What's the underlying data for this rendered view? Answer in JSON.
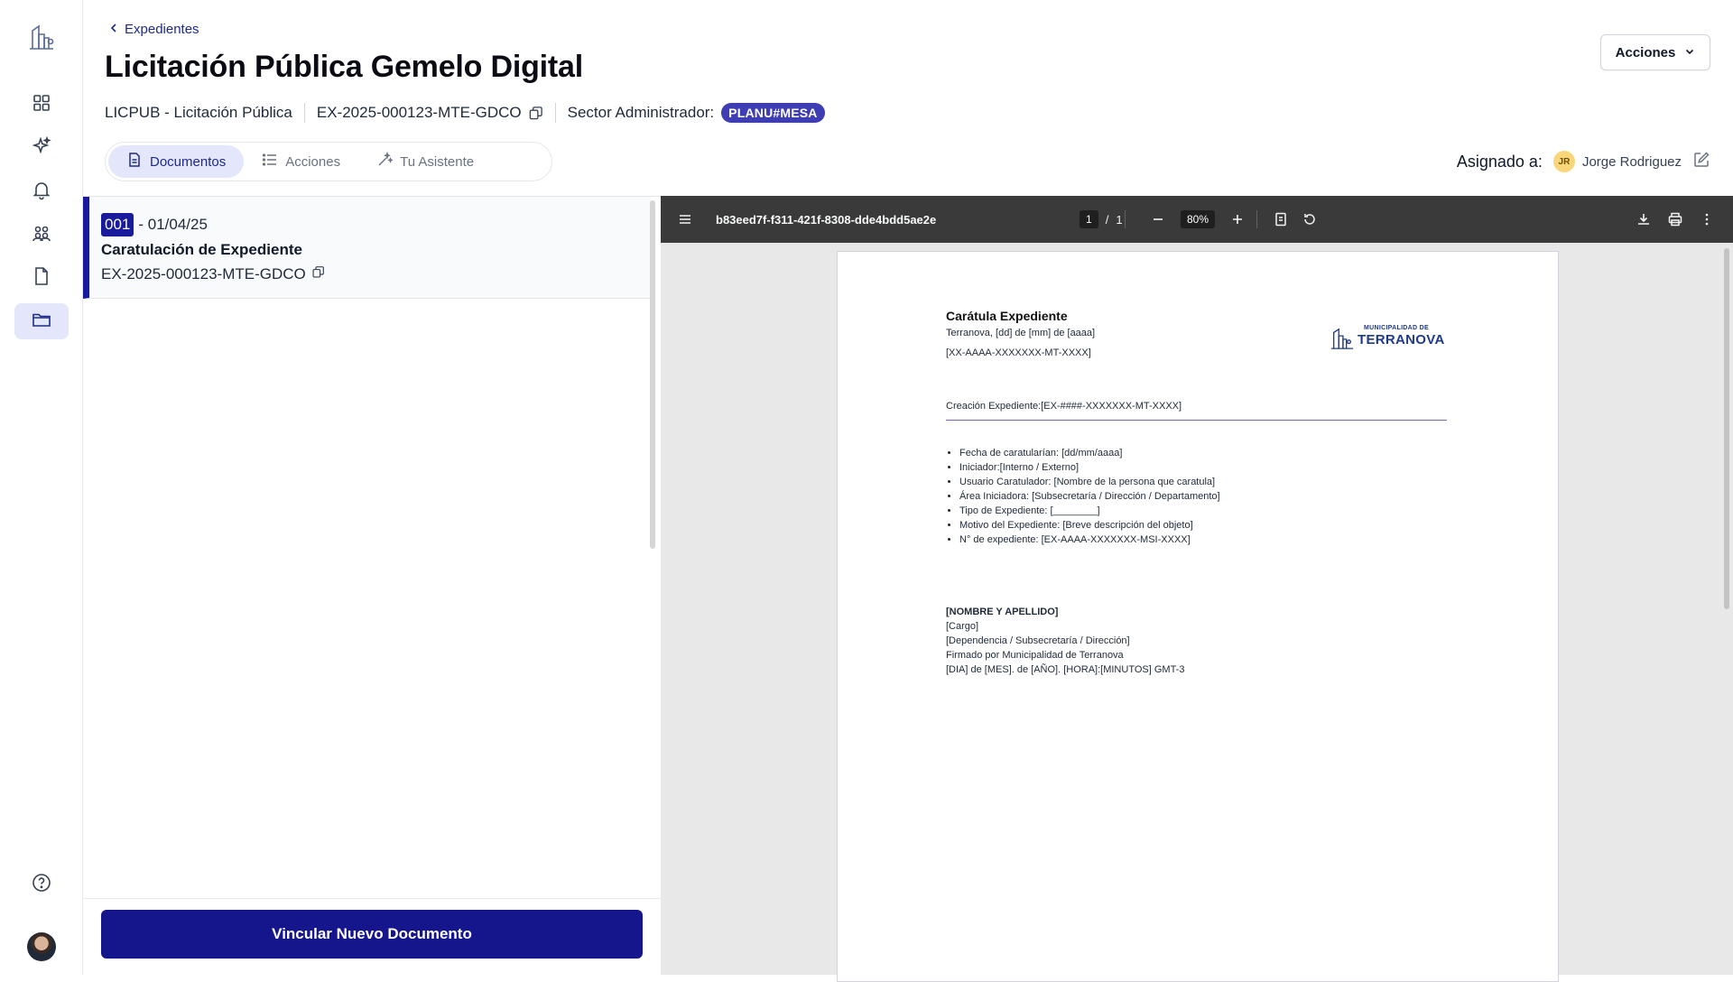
{
  "nav": {
    "items": [
      {
        "name": "dashboard",
        "icon": "grid-icon"
      },
      {
        "name": "ai-assistant",
        "icon": "sparkles-icon"
      },
      {
        "name": "notifications",
        "icon": "bell-icon"
      },
      {
        "name": "teams",
        "icon": "users-group-icon"
      },
      {
        "name": "documents",
        "icon": "document-icon"
      },
      {
        "name": "expedientes",
        "icon": "folder-icon",
        "active": true
      }
    ],
    "help_icon": "help-circle-icon"
  },
  "header": {
    "back_label": "Expedientes",
    "title": "Licitación Pública Gemelo Digital",
    "type": "LICPUB - Licitación Pública",
    "code": "EX-2025-000123-MTE-GDCO",
    "sector_label": "Sector Administrador:",
    "sector_badge": "PLANU#MESA",
    "actions_label": "Acciones"
  },
  "tabs": [
    {
      "label": "Documentos",
      "icon": "document-icon",
      "active": true
    },
    {
      "label": "Acciones",
      "icon": "list-icon",
      "active": false
    },
    {
      "label": "Tu Asistente",
      "icon": "magic-wand-icon",
      "active": false
    }
  ],
  "assigned": {
    "label": "Asignado a:",
    "initials": "JR",
    "name": "Jorge Rodriguez"
  },
  "documents": [
    {
      "number": "001",
      "date": "- 01/04/25",
      "title": "Caratulación de Expediente",
      "code": "EX-2025-000123-MTE-GDCO"
    }
  ],
  "link_button": "Vincular Nuevo Documento",
  "viewer": {
    "file_name": "b83eed7f-f311-421f-8308-dde4bdd5ae2e",
    "page": "1",
    "page_sep": "/",
    "total_pages": "1",
    "zoom": "80%"
  },
  "pdf": {
    "heading": "Carátula Expediente",
    "place_date": "Terranova, [dd] de [mm]  de [aaaa]",
    "ref": "[XX-AAAA-XXXXXXX-MT-XXXX]",
    "logo_top": "MUNICIPALIDAD DE",
    "logo_city": "TERRANOVA",
    "creation": "Creación Expediente:[EX-####-XXXXXXX-MT-XXXX]",
    "list": [
      "Fecha de caratularían: [dd/mm/aaaa]",
      "Iniciador:[Interno / Externo]",
      "Usuario Caratulador: [Nombre de la persona que caratula]",
      "Área Iniciadora: [Subsecretaría / Dirección / Departamento]",
      "Tipo de Expediente: [________]",
      "Motivo del Expediente: [Breve descripción del objeto]",
      "N° de expediente: [EX-AAAA-XXXXXXX-MSI-XXXX]"
    ],
    "sign": {
      "name": "[NOMBRE Y APELLIDO]",
      "role": "[Cargo]",
      "dependency": "[Dependencia / Subsecretaría / Dirección]",
      "signed_by": "Firmado por Municipalidad de Terranova",
      "timestamp": "[DIA] de [MES]. de [AÑO]. [HORA]:[MINUTOS] GMT-3"
    }
  },
  "colors": {
    "primary": "#16168c",
    "badge": "#3f3db3",
    "active_bg": "#e4e6fb",
    "viewer_bar": "#3a3a3a"
  }
}
